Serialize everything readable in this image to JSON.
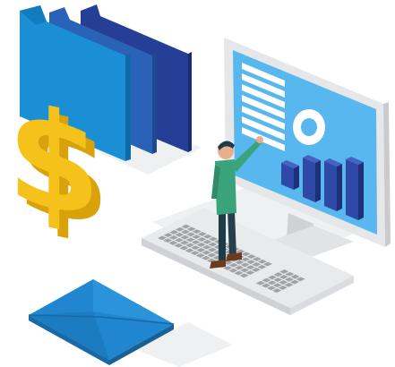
{
  "scene": {
    "description_free": true,
    "colors": {
      "background": "#ffffff",
      "folder_front": "#1a8fd6",
      "folder_middle": "#2a62b8",
      "folder_back": "#253f96",
      "dollar": "#f5c21b",
      "dollar_shade": "#d9a10a",
      "monitor_frame": "#e6e7e9",
      "monitor_edge": "#c9cbce",
      "screen": "#57b7ee",
      "bar": "#2f4aa6",
      "bar_shade": "#1d2f78",
      "keyboard": "#e9eaec",
      "keys": "#9fa2a6",
      "envelope": "#1f86cf",
      "envelope_shade": "#1869a8",
      "person_shirt": "#3aa37c",
      "person_pants": "#1f3b48"
    },
    "icons": [
      "folder-icon",
      "dollar-sign-icon",
      "monitor-icon",
      "bar-chart-icon",
      "donut-chart-icon",
      "keyboard-icon",
      "envelope-icon",
      "person-icon"
    ]
  }
}
